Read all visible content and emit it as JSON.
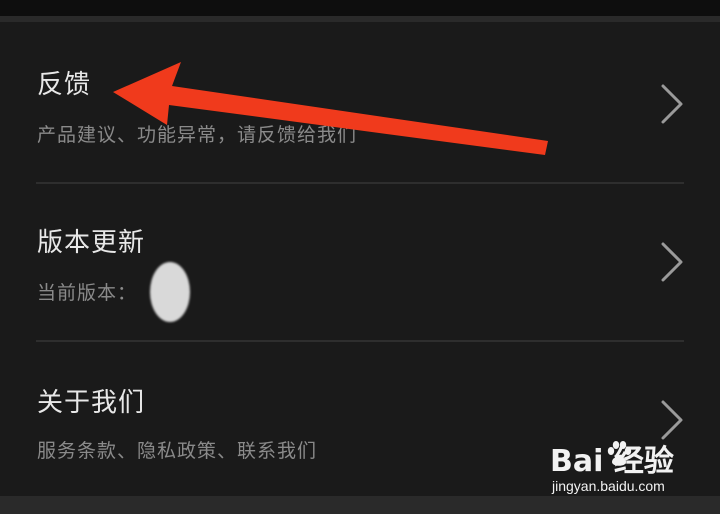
{
  "settings": {
    "items": [
      {
        "title": "反馈",
        "subtitle": "产品建议、功能异常，请反馈给我们",
        "chevron_icon": "chevron-right-icon"
      },
      {
        "title": "版本更新",
        "subtitle": "当前版本：",
        "chevron_icon": "chevron-right-icon"
      },
      {
        "title": "关于我们",
        "subtitle": "服务条款、隐私政策、联系我们",
        "chevron_icon": "chevron-right-icon"
      }
    ]
  },
  "annotation": {
    "arrow_color": "#f03a1c"
  },
  "watermark": {
    "brand": "Bai  经验",
    "url": "jingyan.baidu.com"
  },
  "colors": {
    "background": "#1a1a1a",
    "title_text": "#e8e8e8",
    "subtitle_text": "#8a8a8a",
    "divider": "#2e2e2e"
  }
}
